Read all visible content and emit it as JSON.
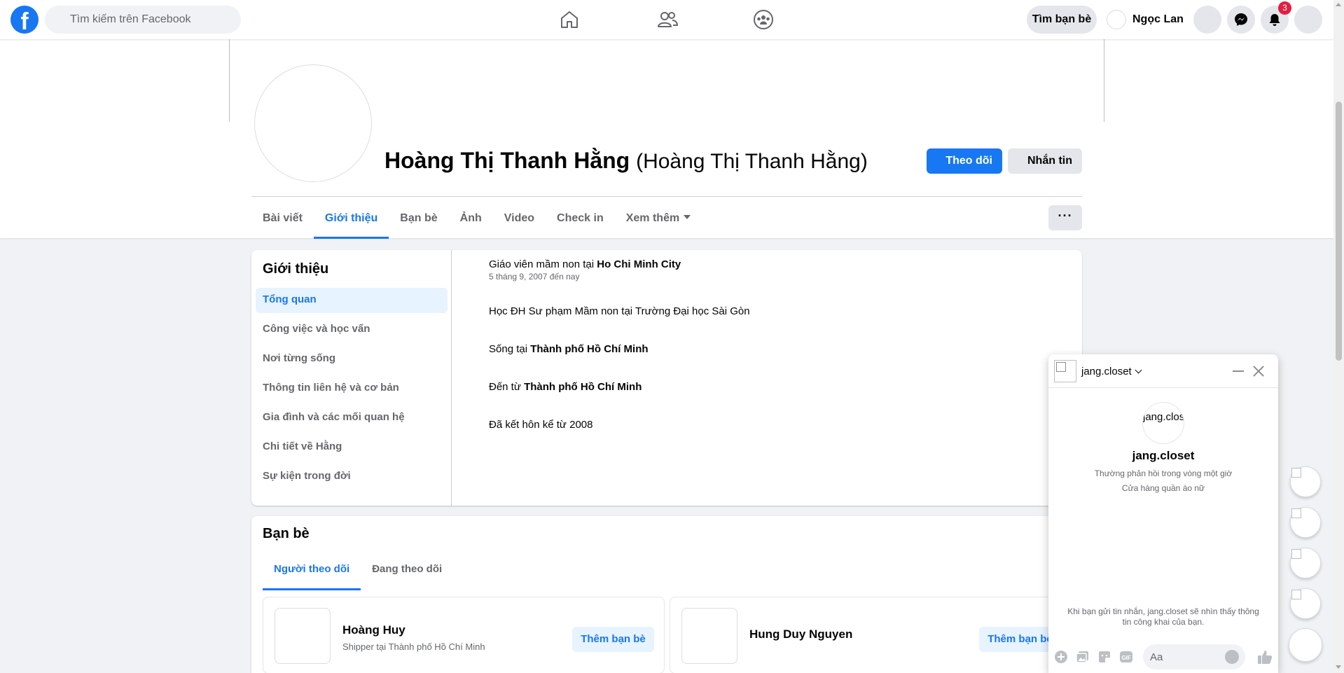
{
  "topbar": {
    "logo_text": "f",
    "search_placeholder": "Tìm kiếm trên Facebook",
    "find_friends_label": "Tìm bạn bè",
    "user_name": "Ngọc Lan",
    "notification_count": "3",
    "icons": [
      "home-icon",
      "friends-icon",
      "groups-icon",
      "menu-icon",
      "messenger-icon",
      "bell-icon",
      "account-icon"
    ],
    "brand_color": "#1877f2"
  },
  "profile": {
    "name": "Hoàng Thị Thanh Hằng",
    "alt_name": "(Hoàng Thị Thanh Hằng)",
    "follow_label": "Theo dõi",
    "message_label": "Nhắn tin",
    "more_label": "···"
  },
  "tabs": [
    {
      "label": "Bài viết",
      "active": false
    },
    {
      "label": "Giới thiệu",
      "active": true
    },
    {
      "label": "Bạn bè",
      "active": false
    },
    {
      "label": "Ảnh",
      "active": false
    },
    {
      "label": "Video",
      "active": false
    },
    {
      "label": "Check in",
      "active": false
    },
    {
      "label": "Xem thêm",
      "active": false
    }
  ],
  "about": {
    "title": "Giới thiệu",
    "menu": [
      "Tổng quan",
      "Công việc và học vấn",
      "Nơi từng sống",
      "Thông tin liên hệ và cơ bản",
      "Gia đình và các mối quan hệ",
      "Chi tiết về Hằng",
      "Sự kiện trong đời"
    ],
    "work_prefix": "Giáo viên mầm non tại ",
    "work_place": "Ho Chi Minh City",
    "work_dates": "5 tháng 9, 2007 đến nay",
    "education": "Học ĐH Sư phạm Mầm non tại Trường Đại học Sài Gòn",
    "lives_prefix": "Sống tại ",
    "lives_place": "Thành phố Hồ Chí Minh",
    "from_prefix": "Đến từ ",
    "from_place": "Thành phố Hồ Chí Minh",
    "relationship": "Đã kết hôn kể từ 2008"
  },
  "friends": {
    "title": "Bạn bè",
    "tabs": [
      "Người theo dõi",
      "Đang theo dõi"
    ],
    "items": [
      {
        "name": "Hoàng Huy",
        "subtitle": "Shipper tại Thành phố Hồ Chí Minh",
        "button": "Thêm bạn bè"
      },
      {
        "name": "Hung Duy Nguyen",
        "subtitle": "",
        "button": "Thêm bạn bè"
      }
    ]
  },
  "chat": {
    "name": "jang.closet",
    "avatar_text": "jang.clos",
    "response_time": "Thường phản hồi trong vòng một giờ",
    "description": "Cửa hàng quần áo nữ",
    "notice": "Khi bạn gửi tin nhắn, jang.closet sẽ nhìn thấy thông tin công khai của bạn.",
    "input_placeholder": "Aa"
  }
}
